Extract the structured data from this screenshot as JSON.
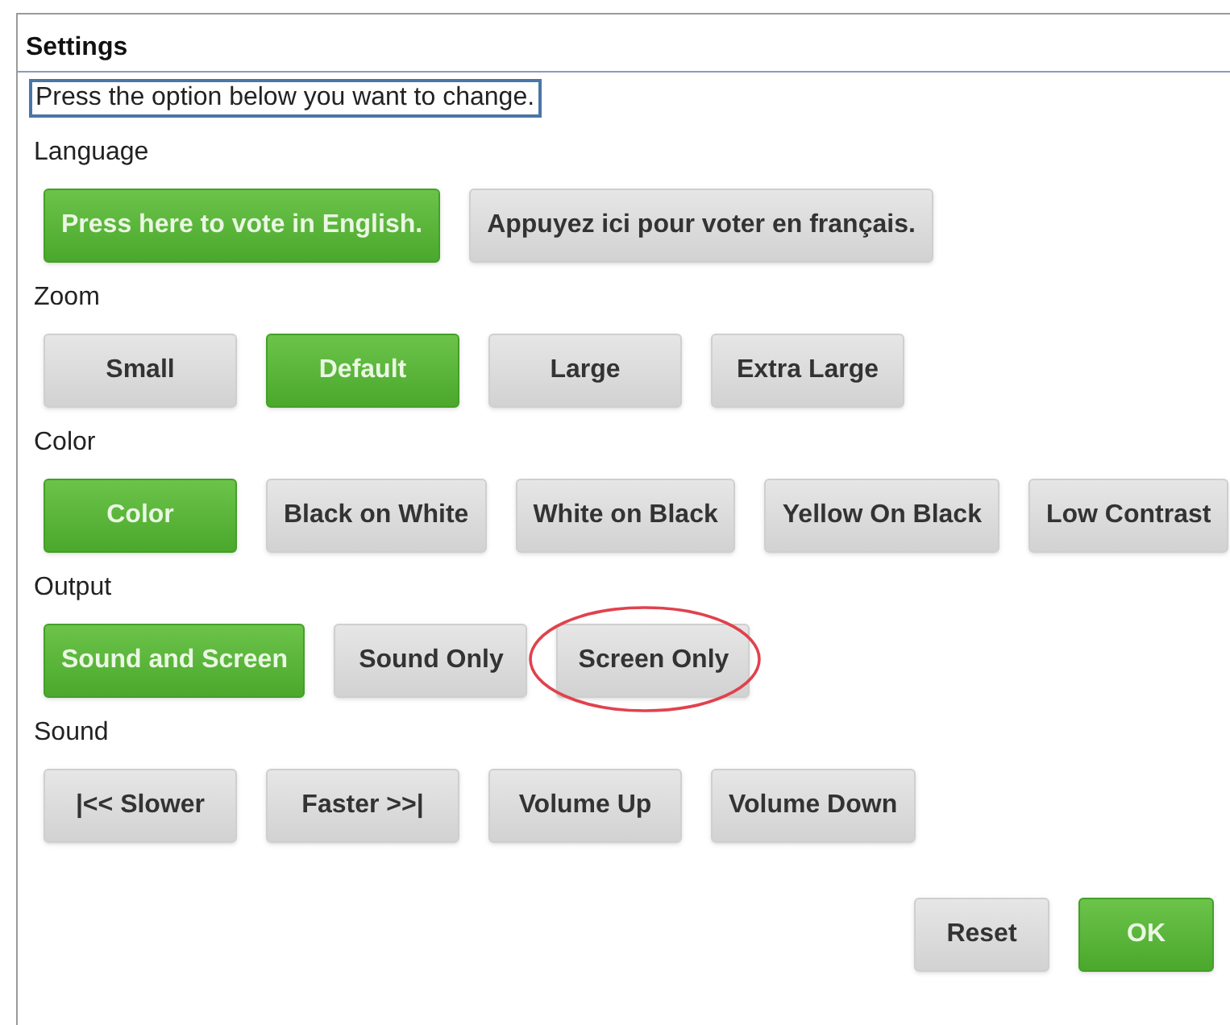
{
  "title": "Settings",
  "instruction": "Press the option below you want to change.",
  "sections": [
    {
      "label": "Language",
      "options": [
        {
          "label": "Press here to vote in English.",
          "selected": true,
          "highlighted": false
        },
        {
          "label": "Appuyez ici pour voter en français.",
          "selected": false,
          "highlighted": false
        }
      ]
    },
    {
      "label": "Zoom",
      "options": [
        {
          "label": "Small",
          "selected": false,
          "highlighted": false
        },
        {
          "label": "Default",
          "selected": true,
          "highlighted": false
        },
        {
          "label": "Large",
          "selected": false,
          "highlighted": false
        },
        {
          "label": "Extra Large",
          "selected": false,
          "highlighted": false
        }
      ]
    },
    {
      "label": "Color",
      "options": [
        {
          "label": "Color",
          "selected": true,
          "highlighted": false
        },
        {
          "label": "Black on White",
          "selected": false,
          "highlighted": false
        },
        {
          "label": "White on Black",
          "selected": false,
          "highlighted": false
        },
        {
          "label": "Yellow On Black",
          "selected": false,
          "highlighted": false
        },
        {
          "label": "Low Contrast",
          "selected": false,
          "highlighted": false
        }
      ]
    },
    {
      "label": "Output",
      "options": [
        {
          "label": "Sound and Screen",
          "selected": true,
          "highlighted": false
        },
        {
          "label": "Sound Only",
          "selected": false,
          "highlighted": false
        },
        {
          "label": "Screen Only",
          "selected": false,
          "highlighted": true
        }
      ]
    },
    {
      "label": "Sound",
      "options": [
        {
          "label": "|<< Slower",
          "selected": false,
          "highlighted": false
        },
        {
          "label": "Faster >>|",
          "selected": false,
          "highlighted": false
        },
        {
          "label": "Volume Up",
          "selected": false,
          "highlighted": false
        },
        {
          "label": "Volume Down",
          "selected": false,
          "highlighted": false
        }
      ]
    }
  ],
  "footer_buttons": [
    {
      "label": "Reset",
      "kind": "secondary"
    },
    {
      "label": "OK",
      "kind": "primary"
    }
  ]
}
